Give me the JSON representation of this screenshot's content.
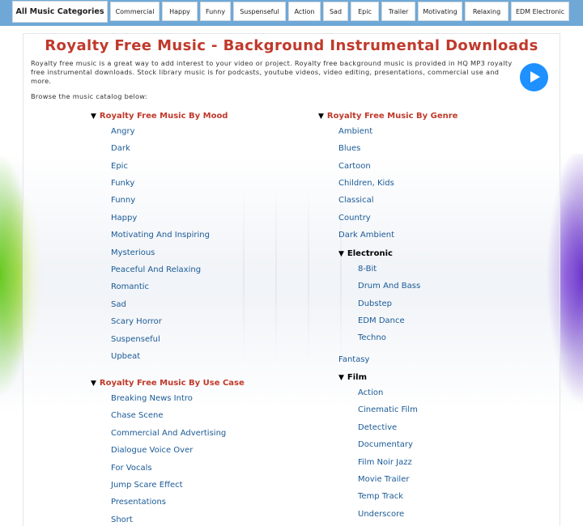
{
  "nav": {
    "items": [
      "All Music Categories",
      "Commercial",
      "Happy",
      "Funny",
      "Suspenseful",
      "Action",
      "Sad",
      "Epic",
      "Trailer",
      "Motivating",
      "Relaxing",
      "EDM Electronic"
    ]
  },
  "page": {
    "title": "Royalty Free Music - Background Instrumental Downloads",
    "intro": "Royalty free music is a great way to add interest to your video or project. Royalty free background music is provided in HQ MP3 royalty free instrumental downloads. Stock library music is for podcasts, youtube videos, video editing, presentations, commercial use and more.",
    "browse": "Browse the music catalog below:"
  },
  "mood": {
    "heading": "Royalty Free Music By Mood",
    "items": [
      "Angry",
      "Dark",
      "Epic",
      "Funky",
      "Funny",
      "Happy",
      "Motivating And Inspiring",
      "Mysterious",
      "Peaceful And Relaxing",
      "Romantic",
      "Sad",
      "Scary Horror",
      "Suspenseful",
      "Upbeat"
    ]
  },
  "usecase": {
    "heading": "Royalty Free Music By Use Case",
    "items": [
      "Breaking News Intro",
      "Chase Scene",
      "Commercial And Advertising",
      "Dialogue Voice Over",
      "For Vocals",
      "Jump Scare Effect",
      "Presentations",
      "Short"
    ]
  },
  "genre": {
    "heading": "Royalty Free Music By Genre",
    "items_top": [
      "Ambient",
      "Blues",
      "Cartoon",
      "Children, Kids",
      "Classical",
      "Country",
      "Dark Ambient"
    ],
    "electronic": {
      "heading": "Electronic",
      "items": [
        "8-Bit",
        "Drum And Bass",
        "Dubstep",
        "EDM Dance",
        "Techno"
      ]
    },
    "fantasy": "Fantasy",
    "film": {
      "heading": "Film",
      "items": [
        "Action",
        "Cinematic Film",
        "Detective",
        "Documentary",
        "Film Noir Jazz",
        "Movie Trailer",
        "Temp Track",
        "Underscore"
      ]
    }
  },
  "triangle_glyph": "▼"
}
